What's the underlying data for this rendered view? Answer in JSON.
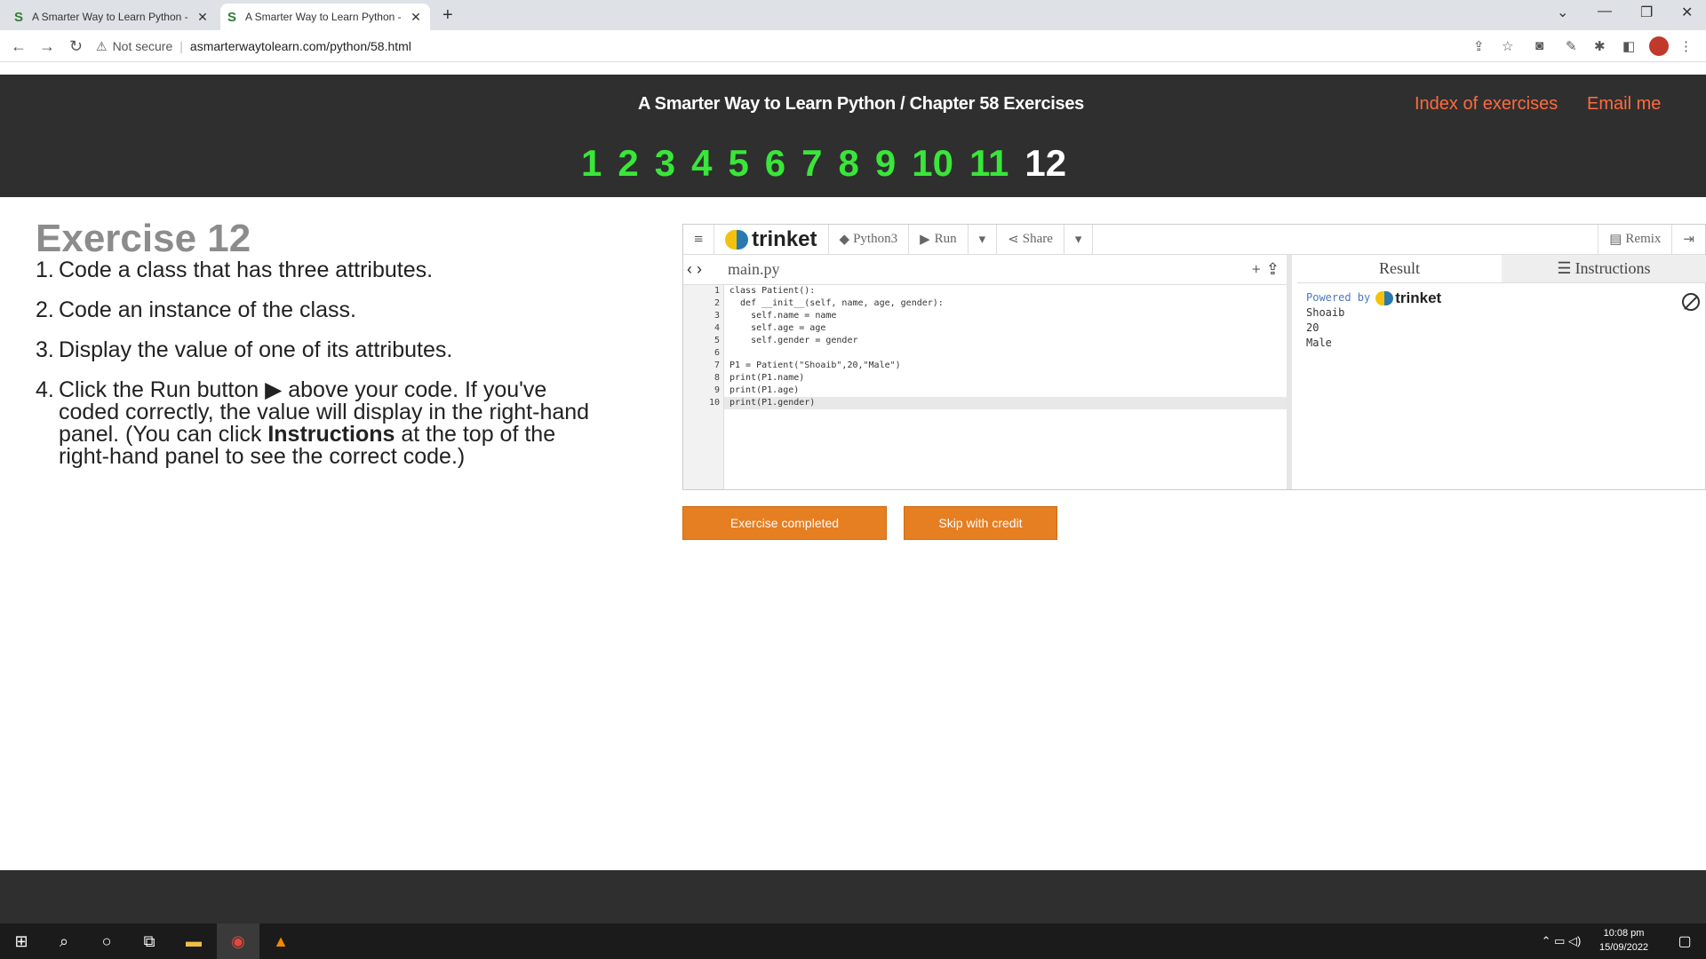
{
  "browser": {
    "tabs": [
      {
        "title": "A Smarter Way to Learn Python -",
        "favicon": "S"
      },
      {
        "title": "A Smarter Way to Learn Python -",
        "favicon": "S"
      }
    ],
    "new_tab": "+",
    "security": "Not secure",
    "url": "asmarterwaytolearn.com/python/58.html"
  },
  "site": {
    "title": "A Smarter Way to Learn Python / Chapter 58 Exercises",
    "index_link": "Index of exercises",
    "email_link": "Email me",
    "exercise_numbers": [
      "1",
      "2",
      "3",
      "4",
      "5",
      "6",
      "7",
      "8",
      "9",
      "10",
      "11",
      "12"
    ],
    "current_number": "12"
  },
  "exercise": {
    "heading": "Exercise 12",
    "steps": [
      {
        "n": "1.",
        "text": "Code a class that has three attributes."
      },
      {
        "n": "2.",
        "text": "Code an instance of the class."
      },
      {
        "n": "3.",
        "text": "Display the value of one of its attributes."
      },
      {
        "n": "4.",
        "pre": "Click the Run button ▶ above your code. If you've coded correctly, the value will display in the right-hand panel. (You can click ",
        "bold": "Instructions",
        "post": " at the top of the right-hand panel to see the correct code.)"
      }
    ]
  },
  "trinket": {
    "logo_text": "trinket",
    "language": "Python3",
    "run": "Run",
    "share": "Share",
    "remix": "Remix",
    "filename": "main.py",
    "line_numbers": [
      "1",
      "2",
      "3",
      "4",
      "5",
      "6",
      "7",
      "8",
      "9",
      "10"
    ],
    "code_lines": [
      "class Patient():",
      "  def __init__(self, name, age, gender):",
      "    self.name = name",
      "    self.age = age",
      "    self.gender = gender",
      "",
      "P1 = Patient(\"Shoaib\",20,\"Male\")",
      "print(P1.name)",
      "print(P1.age)",
      "print(P1.gender)"
    ],
    "tab_result": "Result",
    "tab_instructions": "Instructions",
    "powered_by": "Powered by",
    "output": [
      "Shoaib",
      "20",
      "Male"
    ]
  },
  "buttons": {
    "completed": "Exercise completed",
    "skip": "Skip with credit"
  },
  "taskbar": {
    "time": "10:08 pm",
    "date": "15/09/2022"
  }
}
